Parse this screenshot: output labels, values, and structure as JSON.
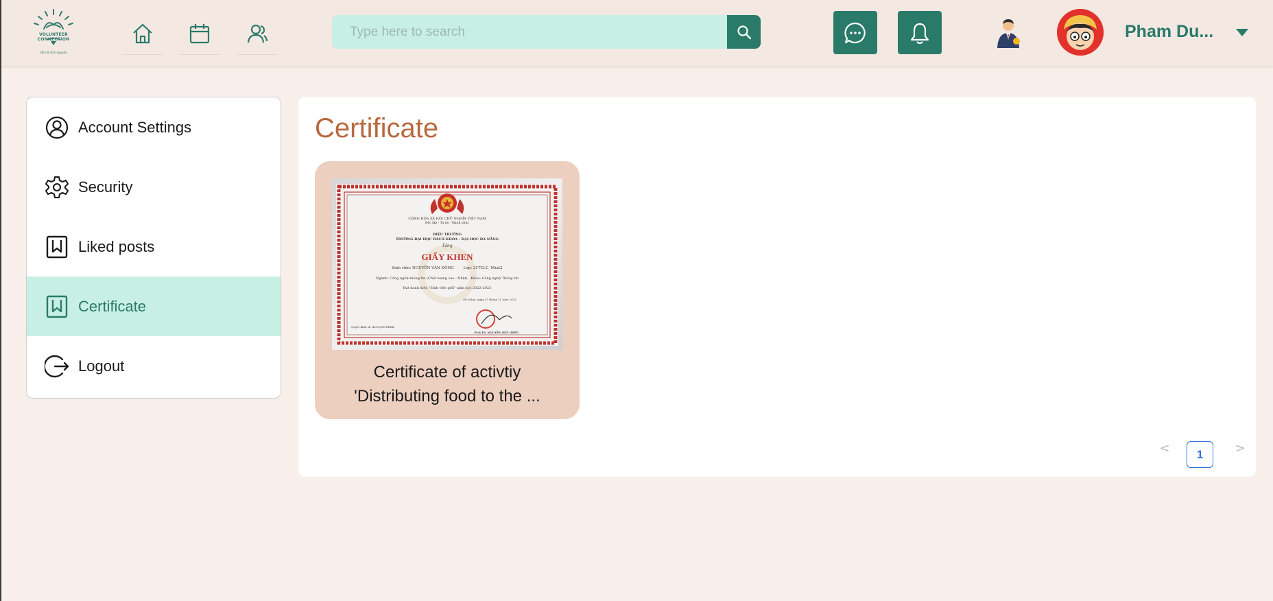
{
  "header": {
    "logo_text": "VOLUNTEER CONNECTION",
    "logo_subtext": "kết nối tình nguyện",
    "nav": [
      {
        "name": "home",
        "icon": "home-icon"
      },
      {
        "name": "calendar",
        "icon": "calendar-icon"
      },
      {
        "name": "community",
        "icon": "users-icon"
      }
    ],
    "search": {
      "placeholder": "Type here to search",
      "value": ""
    },
    "user_name": "Pham Du...",
    "accent_color": "#2a7a69"
  },
  "sidebar": {
    "items": [
      {
        "label": "Account Settings",
        "icon": "user-circle-icon",
        "active": false
      },
      {
        "label": "Security",
        "icon": "gear-icon",
        "active": false
      },
      {
        "label": "Liked posts",
        "icon": "bookmark-icon",
        "active": false
      },
      {
        "label": "Certificate",
        "icon": "bookmark-icon",
        "active": true
      },
      {
        "label": "Logout",
        "icon": "logout-icon",
        "active": false
      }
    ]
  },
  "main": {
    "title": "Certificate",
    "certificates": [
      {
        "caption_line1": "Certificate of activtiy",
        "caption_line2": "'Distributing food to the ...",
        "image": {
          "header_line1": "CỘNG HÒA XÃ HỘI CHỦ NGHĨA VIỆT NAM",
          "header_line2": "Độc lập - Tự do - Hạnh phúc",
          "header_line3": "HIỆU TRƯỞNG",
          "header_line4": "TRƯỜNG ĐẠI HỌC BÁCH KHOA - ĐẠI HỌC ĐÀ NẴNG",
          "header_line5": "Tặng",
          "award_title": "GIẤY KHEN",
          "line_student": "Sinh viên: NGUYỄN VĂN ĐÔNG        Lớp: 21TCLC_Nhat2",
          "line_major": "Ngành: Công nghệ thông tin (Chất lượng cao - Nhật)   Khoa: Công nghệ Thông tin",
          "line_achievement": "Đạt danh hiệu \"Sinh viên giỏi\" năm học 2022-2023",
          "line_date": "Đà Nẵng, ngày 07 tháng 11 năm 2023",
          "line_ref": "Quyết định số: 4292/QĐ-ĐHBK",
          "signer": "PGS.TS. NGUYỄN HỮU HIẾU"
        }
      }
    ],
    "pagination": {
      "current": "1",
      "prev": "<",
      "next": ">"
    }
  }
}
